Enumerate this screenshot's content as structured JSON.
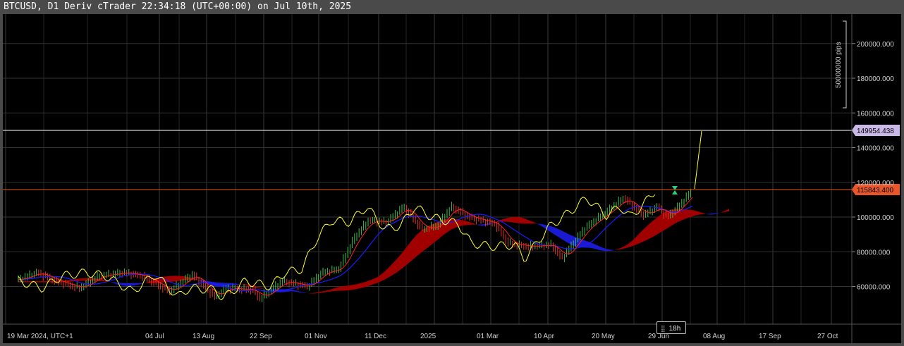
{
  "window": {
    "title": "BTCUSD, D1 Deriv cTrader 22:34:18 (UTC+00:00) on Jul 10th, 2025"
  },
  "period_badge": "18h",
  "colors": {
    "background": "#000000",
    "price_line_white": "#ffffff",
    "price_line_orange": "#e8562a",
    "marker_white_bg": "#c9b8e8",
    "marker_orange_bg": "#e8562a",
    "candle_up": "#3cbf4a",
    "candle_down": "#e0362a",
    "chikou": "#ffff33",
    "tenkan": "#ff2222",
    "kijun": "#1a1aff",
    "kumo_bull": "#1a1ad0",
    "kumo_bear": "#a00000"
  },
  "chart_data": {
    "type": "line",
    "symbol": "BTCUSD",
    "timeframe": "D1",
    "y_axis": {
      "ticks": [
        "60000.000",
        "80000.000",
        "100000.000",
        "120000.000",
        "140000.000",
        "160000.000",
        "180000.000",
        "200000.000"
      ],
      "range": [
        50000,
        220000
      ]
    },
    "x_axis": {
      "ticks": [
        "19 Mar 2024, UTC+1",
        "04 Jul",
        "13 Aug",
        "22 Sep",
        "01 Nov",
        "11 Dec",
        "2025",
        "01 Mar",
        "10 Apr",
        "20 May",
        "29 Jun",
        "08 Aug",
        "17 Sep",
        "27 Oct"
      ]
    },
    "price_markers": [
      {
        "label": "149954.438",
        "value": 149954.438
      },
      {
        "label": "115843.400",
        "value": 115843.4
      }
    ],
    "ruler_label": "50000000 pips",
    "grid": true,
    "series_prices": [
      [
        "2024-03-19",
        64000
      ],
      [
        "2024-04-01",
        68000
      ],
      [
        "2024-04-15",
        63000
      ],
      [
        "2024-05-01",
        59000
      ],
      [
        "2024-05-15",
        66000
      ],
      [
        "2024-06-01",
        68000
      ],
      [
        "2024-06-15",
        66000
      ],
      [
        "2024-07-04",
        57000
      ],
      [
        "2024-07-20",
        67000
      ],
      [
        "2024-08-05",
        54000
      ],
      [
        "2024-08-13",
        59000
      ],
      [
        "2024-09-01",
        58000
      ],
      [
        "2024-09-06",
        53000
      ],
      [
        "2024-09-22",
        63000
      ],
      [
        "2024-10-10",
        60000
      ],
      [
        "2024-10-20",
        68000
      ],
      [
        "2024-11-01",
        70000
      ],
      [
        "2024-11-12",
        88000
      ],
      [
        "2024-11-22",
        98000
      ],
      [
        "2024-12-05",
        97000
      ],
      [
        "2024-12-17",
        106000
      ],
      [
        "2024-12-30",
        93000
      ],
      [
        "2025-01-10",
        95000
      ],
      [
        "2025-01-20",
        106000
      ],
      [
        "2025-02-01",
        100000
      ],
      [
        "2025-02-20",
        96000
      ],
      [
        "2025-03-01",
        85000
      ],
      [
        "2025-03-15",
        83000
      ],
      [
        "2025-04-01",
        84000
      ],
      [
        "2025-04-08",
        76000
      ],
      [
        "2025-04-25",
        94000
      ],
      [
        "2025-05-10",
        103000
      ],
      [
        "2025-05-22",
        111000
      ],
      [
        "2025-06-05",
        101000
      ],
      [
        "2025-06-15",
        106000
      ],
      [
        "2025-06-22",
        100000
      ],
      [
        "2025-07-01",
        107000
      ],
      [
        "2025-07-10",
        115800
      ]
    ]
  }
}
